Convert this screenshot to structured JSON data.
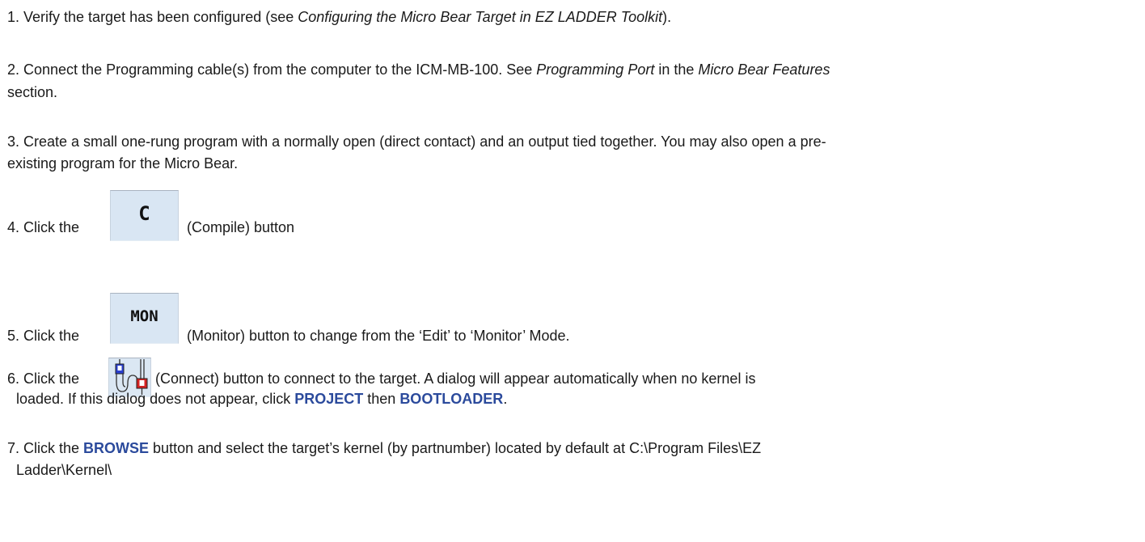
{
  "step1": {
    "pre": "1.  Verify the target has been configured (see ",
    "ref": "Configuring the Micro Bear Target in EZ LADDER Toolkit",
    "post": ")."
  },
  "step2": {
    "pre": "2.  Connect the Programming cable(s) from the computer to the ICM-MB-100.  See ",
    "ref1": "Programming Port",
    "mid": " in the ",
    "ref2": "Micro Bear Features",
    "line2": "section."
  },
  "step3": {
    "line1": "3.  Create a small one-rung program with a normally open (direct contact) and an output tied together.  You may also open a pre-",
    "line2": "existing program for the Micro Bear."
  },
  "step4": {
    "pre": "4.  Click the ",
    "post": "(Compile) button",
    "button_label": "C"
  },
  "step5": {
    "pre": "5.  Click the ",
    "post": "(Monitor) button to change from the ‘Edit’ to ‘Monitor’ Mode.",
    "button_label": "MON"
  },
  "step6": {
    "pre": "6.  Click the ",
    "post": " (Connect) button to connect to the target.  A dialog will appear automatically when no kernel is",
    "line2_pre": "loaded.  If this dialog does not appear, click ",
    "kw1": "PROJECT",
    "line2_mid": " then ",
    "kw2": "BOOTLOADER",
    "line2_post": ".",
    "icon": "connect-plug-icon"
  },
  "step7": {
    "pre": "7. Click the ",
    "kw": "BROWSE",
    "post": " button and select the target’s kernel (by partnumber) located by default at  C:\\Program Files\\EZ",
    "line2": "Ladder\\Kernel\\"
  },
  "colors": {
    "keyword": "#2b4a9c",
    "toolbar_button_bg": "#d9e6f3"
  }
}
